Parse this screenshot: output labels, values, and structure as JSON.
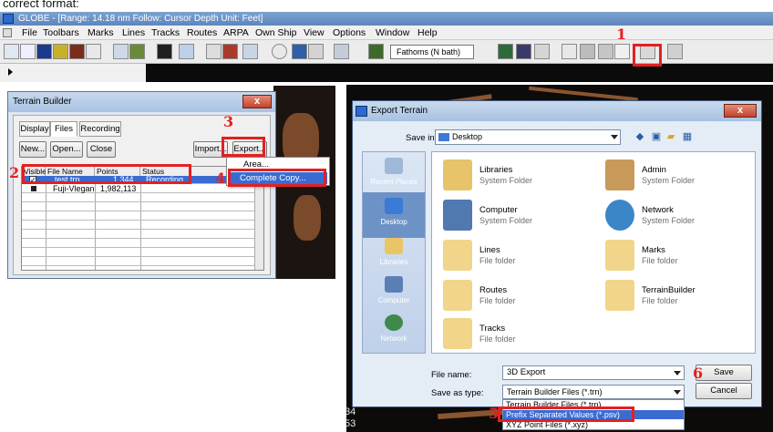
{
  "caption": "correct format:",
  "globe": {
    "title": "GLOBE - [Range: 14.18 nm  Follow: Cursor  Depth Unit: Feet]",
    "menu": [
      "File",
      "Toolbars",
      "Marks",
      "Lines",
      "Tracks",
      "Routes",
      "ARPA",
      "Own Ship",
      "View",
      "Options",
      "Window",
      "Help"
    ],
    "depth_combo": "Fathoms (N bath)"
  },
  "terrain_builder": {
    "title": "Terrain Builder",
    "close": "x",
    "tabs": [
      "Display",
      "Files",
      "Recording"
    ],
    "buttons": {
      "new": "New...",
      "open": "Open...",
      "close": "Close",
      "import": "Import...",
      "export": "Export..."
    },
    "columns": [
      "Visible",
      "File Name",
      "Points",
      "Status"
    ],
    "rows": [
      {
        "name": "test.trn",
        "points": "1,344",
        "status": "Recording"
      },
      {
        "name": "Fuji-Vlegan",
        "points": "1,982,113",
        "status": ""
      }
    ],
    "export_menu": {
      "area": "Area...",
      "complete_copy": "Complete Copy..."
    }
  },
  "export_dialog": {
    "title": "Export Terrain",
    "close": "x",
    "save_in_label": "Save in:",
    "save_in_value": "Desktop",
    "places": [
      "Recent Places",
      "Desktop",
      "Libraries",
      "Computer",
      "Network"
    ],
    "items": [
      {
        "name": "Libraries",
        "type": "System Folder"
      },
      {
        "name": "Admin",
        "type": "System Folder"
      },
      {
        "name": "Computer",
        "type": "System Folder"
      },
      {
        "name": "Network",
        "type": "System Folder"
      },
      {
        "name": "Lines",
        "type": "File folder"
      },
      {
        "name": "Marks",
        "type": "File folder"
      },
      {
        "name": "Routes",
        "type": "File folder"
      },
      {
        "name": "TerrainBuilder",
        "type": "File folder"
      },
      {
        "name": "Tracks",
        "type": "File folder"
      }
    ],
    "file_name_label": "File name:",
    "file_name_value": "3D Export",
    "save_type_label": "Save as type:",
    "save_type_value": "Terrain Builder Files (*.trn)",
    "type_options": [
      "Terrain Builder Files (*.trn)",
      "Prefix Separated Values (*.psv)",
      "XYZ Point Files (*.xyz)"
    ],
    "save": "Save",
    "cancel": "Cancel"
  },
  "step_numbers": [
    "1",
    "2",
    "3",
    "4",
    "5",
    "6"
  ],
  "bottom_numbers": [
    "34",
    "53"
  ],
  "colors": {
    "highlight": "#e32021",
    "selection": "#3b6bd1"
  }
}
